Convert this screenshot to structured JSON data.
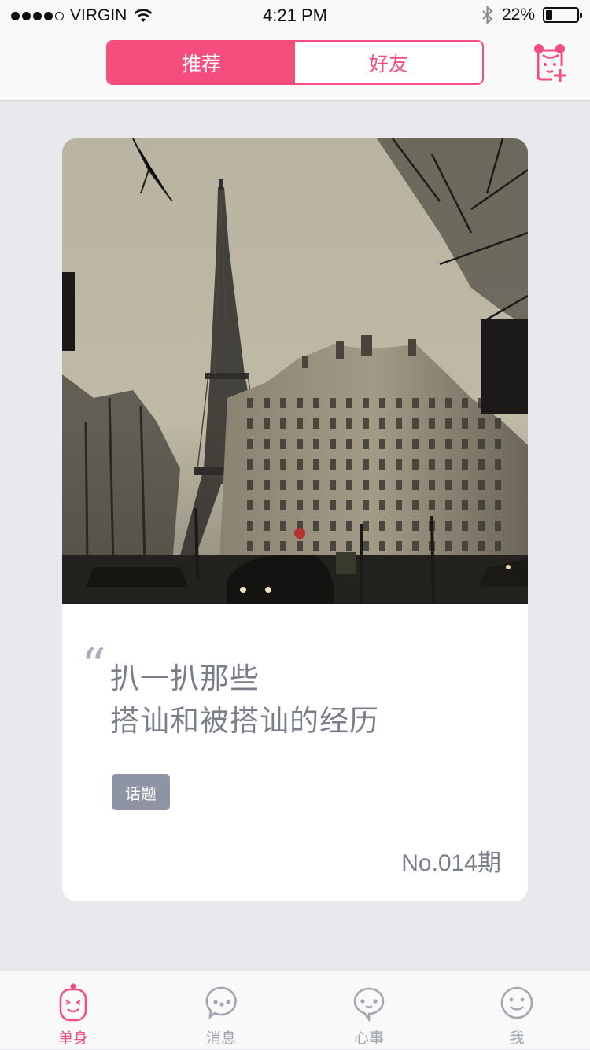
{
  "status_bar": {
    "carrier": "VIRGIN",
    "time": "4:21 PM",
    "battery_text": "22%",
    "battery_level": 0.22
  },
  "nav": {
    "tabs": [
      {
        "label": "推荐",
        "active": true
      },
      {
        "label": "好友",
        "active": false
      }
    ],
    "add_friend_icon": "add-friend-icon"
  },
  "card": {
    "image": "eiffel-tower-paris-street-photo",
    "title_line1": "扒一扒那些",
    "title_line2": "搭讪和被搭讪的经历",
    "tag": "话题",
    "issue": "No.014期"
  },
  "tab_bar": {
    "items": [
      {
        "label": "单身",
        "icon": "single-icon",
        "active": true
      },
      {
        "label": "消息",
        "icon": "message-icon",
        "active": false
      },
      {
        "label": "心事",
        "icon": "heart-talk-icon",
        "active": false
      },
      {
        "label": "我",
        "icon": "me-icon",
        "active": false
      }
    ]
  },
  "colors": {
    "accent": "#f64d7f",
    "tag_bg": "#8e94a3",
    "text_gray": "#7a7e88",
    "background": "#e9e8ec"
  }
}
